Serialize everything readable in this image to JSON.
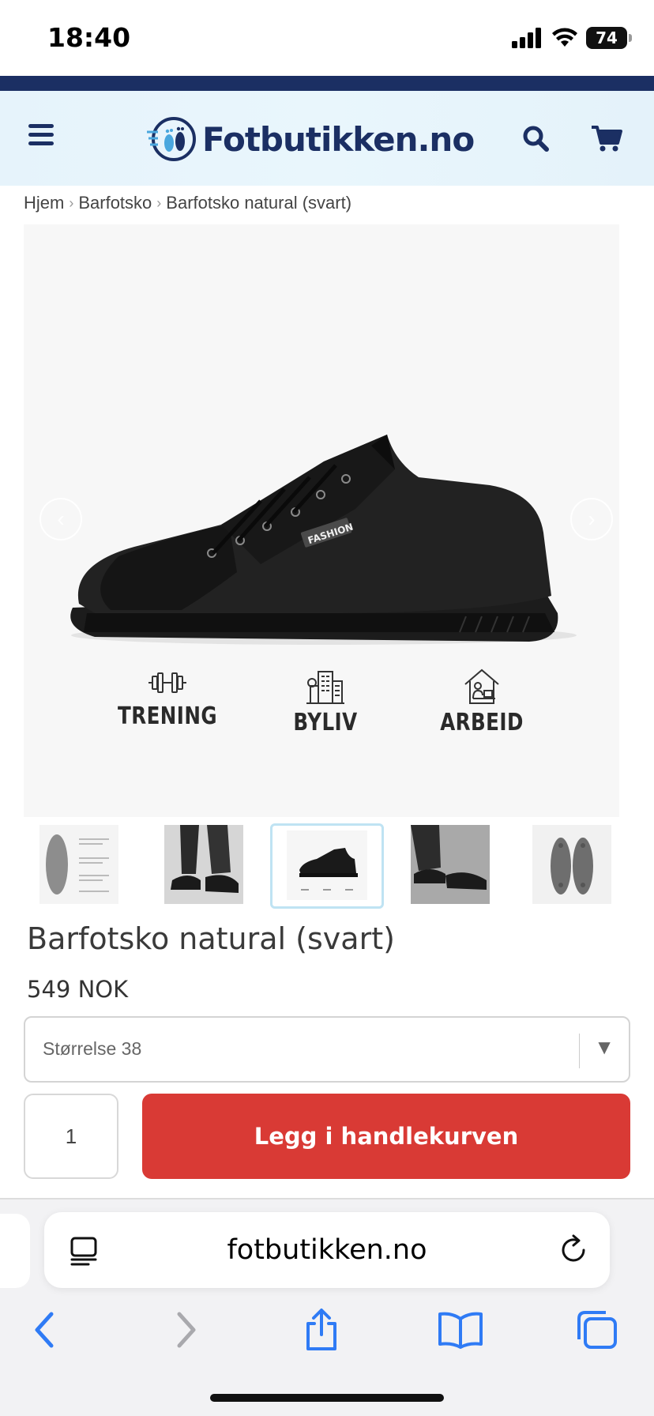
{
  "status_bar": {
    "time": "18:40",
    "battery": "74"
  },
  "header": {
    "logo_text": "Fotbutikken.no",
    "menu_icon": "hamburger-menu-icon",
    "search_icon": "search-icon",
    "cart_icon": "shopping-cart-icon",
    "brand_color": "#1b2f63"
  },
  "breadcrumb": {
    "items": [
      "Hjem",
      "Barfotsko",
      "Barfotsko natural (svart)"
    ]
  },
  "gallery": {
    "shoe_tag": "FASHION",
    "features": [
      "TRENING",
      "BYLIV",
      "ARBEID"
    ],
    "feature_icons": [
      "dumbbell-icon",
      "city-buildings-icon",
      "home-office-icon"
    ],
    "thumbnail_count": 5,
    "selected_thumbnail": 3
  },
  "product": {
    "title": "Barfotsko natural (svart)",
    "price": "549 NOK",
    "size_select": "Størrelse 38",
    "quantity": "1",
    "add_to_cart": "Legg i handlekurven",
    "cart_button_color": "#d93a35"
  },
  "browser": {
    "url": "fotbutikken.no",
    "toolbar": [
      "back-icon",
      "forward-icon",
      "share-icon",
      "bookmarks-icon",
      "tabs-icon"
    ]
  }
}
